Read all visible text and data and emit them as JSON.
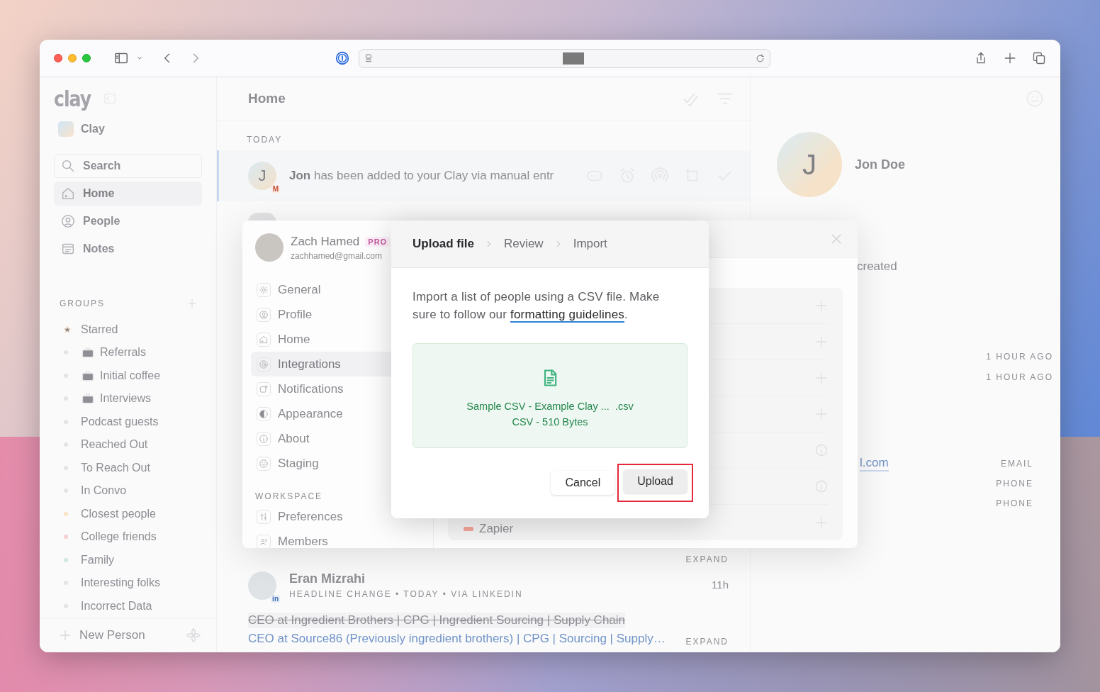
{
  "sidebar": {
    "logo": "clay",
    "workspace": "Clay",
    "nav": [
      {
        "label": "Search",
        "kind": "search",
        "selected": false
      },
      {
        "label": "Home",
        "kind": "home",
        "selected": true
      },
      {
        "label": "People",
        "kind": "person",
        "selected": false
      },
      {
        "label": "Notes",
        "kind": "notes",
        "selected": false
      }
    ],
    "groups_heading": "GROUPS",
    "groups": [
      {
        "label": "Starred",
        "kind": "star"
      },
      {
        "label": "Referrals",
        "kind": "briefcase"
      },
      {
        "label": "Initial coffee",
        "kind": "briefcase"
      },
      {
        "label": "Interviews",
        "kind": "briefcase"
      },
      {
        "label": "Podcast guests",
        "kind": "dot",
        "color": "#e4e4e7"
      },
      {
        "label": "Reached Out",
        "kind": "dot",
        "color": "#e4e4e7"
      },
      {
        "label": "To Reach Out",
        "kind": "dot",
        "color": "#e4e4e7"
      },
      {
        "label": "In Convo",
        "kind": "dot",
        "color": "#e4e4e7"
      },
      {
        "label": "Closest people",
        "kind": "dot",
        "color": "#fbe3c6"
      },
      {
        "label": "College friends",
        "kind": "dot",
        "color": "#f7cfd2"
      },
      {
        "label": "Family",
        "kind": "dot",
        "color": "#cfe9db"
      },
      {
        "label": "Interesting folks",
        "kind": "dot",
        "color": "#e4e4e7"
      },
      {
        "label": "Incorrect Data",
        "kind": "dot",
        "color": "#e4e4e7"
      }
    ],
    "new_person": "New Person"
  },
  "feed": {
    "title": "Home",
    "section": "TODAY",
    "activity": {
      "initial": "J",
      "source_badge": "M",
      "text": "**Jon** has been added to your Clay via manual entr",
      "selected": true
    },
    "expand": "EXPAND",
    "update": {
      "name": "Eran Mizrahi",
      "source_badge": "in",
      "meta": "HEADLINE CHANGE • TODAY • VIA LINKEDIN",
      "time": "11h",
      "old_headline": "CEO at Ingredient Brothers | CPG | Ingredient Sourcing | Supply Chain",
      "new_headline": "CEO at Source86 (Previously ingredient brothers) | CPG | Sourcing | Supply…",
      "expand": "EXPAND"
    }
  },
  "contact": {
    "initial": "J",
    "name": "Jon Doe",
    "created_fragment": "created",
    "timestamps": [
      "1 HOUR AGO",
      "1 HOUR AGO"
    ],
    "email_fragment": "l.com",
    "field_labels": [
      "EMAIL",
      "PHONE",
      "PHONE"
    ]
  },
  "settings": {
    "user": {
      "name": "Zach Hamed",
      "plan_badge": "PRO",
      "email": "zachhamed@gmail.com"
    },
    "nav": [
      {
        "label": "General",
        "kind": "gear",
        "selected": false
      },
      {
        "label": "Profile",
        "kind": "person",
        "selected": false
      },
      {
        "label": "Home",
        "kind": "home",
        "selected": false
      },
      {
        "label": "Integrations",
        "kind": "at",
        "selected": true
      },
      {
        "label": "Notifications",
        "kind": "bell",
        "selected": false
      },
      {
        "label": "Appearance",
        "kind": "contrast",
        "selected": false
      },
      {
        "label": "About",
        "kind": "info",
        "selected": false
      },
      {
        "label": "Staging",
        "kind": "smile",
        "selected": false
      }
    ],
    "workspace_heading": "WORKSPACE",
    "workspace_nav": [
      {
        "label": "Preferences",
        "kind": "sliders",
        "selected": false
      },
      {
        "label": "Members",
        "kind": "people",
        "selected": false
      }
    ],
    "rows": [
      {
        "kind": "add"
      },
      {
        "kind": "add"
      },
      {
        "kind": "add"
      },
      {
        "kind": "add"
      },
      {
        "kind": "info"
      },
      {
        "kind": "info"
      },
      {
        "kind": "add",
        "label": "Zapier"
      }
    ]
  },
  "upload_dialog": {
    "steps": [
      {
        "label": "Upload file",
        "selected": true
      },
      {
        "label": "Review",
        "selected": false
      },
      {
        "label": "Import",
        "selected": false
      }
    ],
    "description": "Import a list of people using a CSV file. Make sure to follow our ",
    "link": "formatting guidelines",
    "description_end": ".",
    "file": {
      "name": "Sample CSV - Example Clay ...  .csv",
      "details": "CSV - 510 Bytes"
    },
    "buttons": [
      {
        "label": "Cancel",
        "kind": "secondary",
        "highlighted": false
      },
      {
        "label": "Upload",
        "kind": "primary",
        "highlighted": true
      }
    ]
  }
}
